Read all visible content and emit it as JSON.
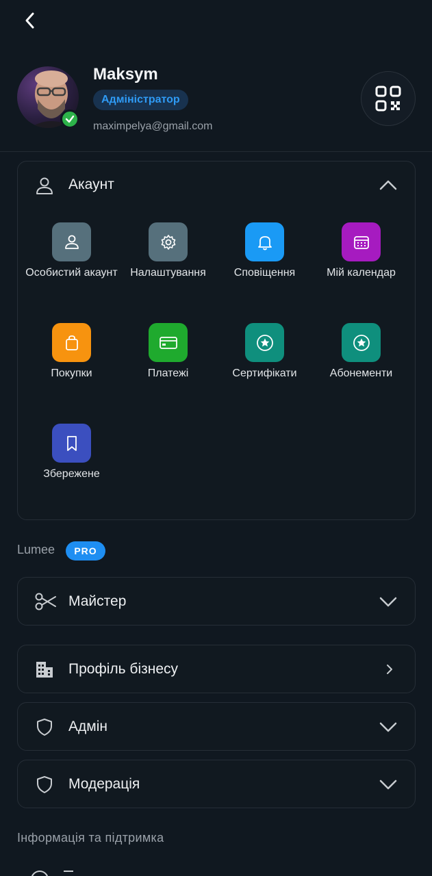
{
  "nav": {
    "back_icon": "chevron-left-icon"
  },
  "profile": {
    "name": "Maksym",
    "role": "Адміністратор",
    "email": "maximpelya@gmail.com",
    "qr_icon": "qr-code-icon",
    "verified_icon": "check-icon"
  },
  "account": {
    "title": "Акаунт",
    "icon": "user-icon",
    "expanded": true,
    "tiles": [
      {
        "label": "Особистий акаунт",
        "icon": "user-icon",
        "color": "#56707c"
      },
      {
        "label": "Налаштування",
        "icon": "gear-icon",
        "color": "#56707c"
      },
      {
        "label": "Сповіщення",
        "icon": "bell-icon",
        "color": "#1a9af5"
      },
      {
        "label": "Мій календар",
        "icon": "calendar-icon",
        "color": "#a61bc0"
      },
      {
        "label": "Покупки",
        "icon": "shopping-bag-icon",
        "color": "#f7930f"
      },
      {
        "label": "Платежі",
        "icon": "credit-card-icon",
        "color": "#1faa2e"
      },
      {
        "label": "Сертифікати",
        "icon": "star-badge-icon",
        "color": "#0f8f7d"
      },
      {
        "label": "Абонементи",
        "icon": "star-badge-icon",
        "color": "#0f8f7d"
      },
      {
        "label": "Збережене",
        "icon": "bookmark-icon",
        "color": "#3b4fbf"
      }
    ]
  },
  "lumee": {
    "label": "Lumee",
    "badge": "PRO"
  },
  "rows": [
    {
      "label": "Майстер",
      "icon": "scissors-icon",
      "chevron": "chevron-down-icon"
    },
    {
      "label": "Профіль бізнесу",
      "icon": "building-icon",
      "chevron": "chevron-right-icon"
    },
    {
      "label": "Адмін",
      "icon": "shield-icon",
      "chevron": "chevron-down-icon"
    },
    {
      "label": "Модерація",
      "icon": "shield-icon",
      "chevron": "chevron-down-icon"
    }
  ],
  "info_section": {
    "label": "Інформація та підтримка"
  }
}
